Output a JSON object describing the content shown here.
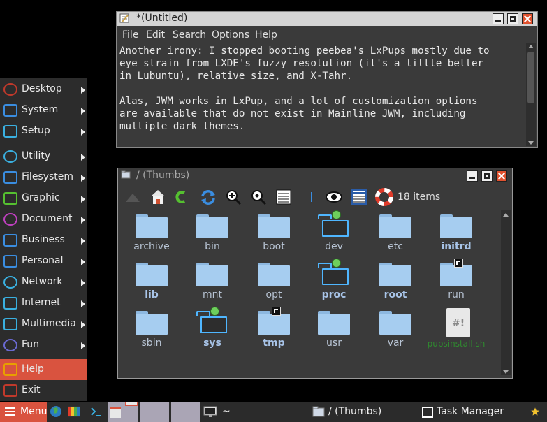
{
  "editor": {
    "title": "*(Untitled)",
    "menu": [
      "File",
      "Edit",
      "Search",
      "Options",
      "Help"
    ],
    "text": "Another irony: I stopped booting peebea's LxPups mostly due to\neye strain from LXDE's fuzzy resolution (it's a little better\nin Lubuntu), relative size, and X-Tahr.\n\nAlas, JWM works in LxPup, and a lot of customization options\nare available that do not exist in Mainline JWM, including\nmultiple dark themes."
  },
  "file_manager": {
    "title": "/ (Thumbs)",
    "items_count": "18 items",
    "items": [
      {
        "name": "archive",
        "style": "normal",
        "badge": ""
      },
      {
        "name": "bin",
        "style": "normal",
        "badge": ""
      },
      {
        "name": "boot",
        "style": "normal",
        "badge": ""
      },
      {
        "name": "dev",
        "style": "outline",
        "badge": "mounted"
      },
      {
        "name": "etc",
        "style": "normal",
        "badge": ""
      },
      {
        "name": "initrd",
        "style": "bold",
        "badge": ""
      },
      {
        "name": "lib",
        "style": "bold",
        "badge": ""
      },
      {
        "name": "mnt",
        "style": "normal",
        "badge": ""
      },
      {
        "name": "opt",
        "style": "normal",
        "badge": ""
      },
      {
        "name": "proc",
        "style": "outline-bold",
        "badge": "mounted"
      },
      {
        "name": "root",
        "style": "bold",
        "badge": ""
      },
      {
        "name": "run",
        "style": "normal",
        "badge": "link"
      },
      {
        "name": "sbin",
        "style": "normal",
        "badge": ""
      },
      {
        "name": "sys",
        "style": "outline-bold",
        "badge": "mounted"
      },
      {
        "name": "tmp",
        "style": "bold",
        "badge": "link"
      },
      {
        "name": "usr",
        "style": "normal",
        "badge": ""
      },
      {
        "name": "var",
        "style": "normal",
        "badge": ""
      },
      {
        "name": "pupsinstall.sh",
        "style": "file",
        "badge": ""
      }
    ]
  },
  "start_menu": {
    "items": [
      {
        "label": "Desktop",
        "icon": "desktop-icon",
        "submenu": true
      },
      {
        "label": "System",
        "icon": "system-icon",
        "submenu": true
      },
      {
        "label": "Setup",
        "icon": "setup-icon",
        "submenu": true
      },
      {
        "label": "Utility",
        "icon": "utility-icon",
        "submenu": true
      },
      {
        "label": "Filesystem",
        "icon": "filesystem-icon",
        "submenu": true
      },
      {
        "label": "Graphic",
        "icon": "graphic-icon",
        "submenu": true
      },
      {
        "label": "Document",
        "icon": "document-icon",
        "submenu": true
      },
      {
        "label": "Business",
        "icon": "business-icon",
        "submenu": true
      },
      {
        "label": "Personal",
        "icon": "personal-icon",
        "submenu": true
      },
      {
        "label": "Network",
        "icon": "network-icon",
        "submenu": true
      },
      {
        "label": "Internet",
        "icon": "internet-icon",
        "submenu": true
      },
      {
        "label": "Multimedia",
        "icon": "multimedia-icon",
        "submenu": true
      },
      {
        "label": "Fun",
        "icon": "fun-icon",
        "submenu": true
      },
      {
        "label": "Help",
        "icon": "help-icon",
        "submenu": false
      },
      {
        "label": "Exit",
        "icon": "exit-icon",
        "submenu": false
      }
    ]
  },
  "taskbar": {
    "menu_label": "Menu",
    "terminal_label": "~",
    "tasks": [
      "/ (Thumbs)",
      "Task Manager"
    ]
  },
  "colors": {
    "accent": "#d9533f",
    "folder": "#a6cdf0",
    "mounted_folder_outline": "#4fb6ff",
    "mounted_dot": "#6ecf5c"
  }
}
